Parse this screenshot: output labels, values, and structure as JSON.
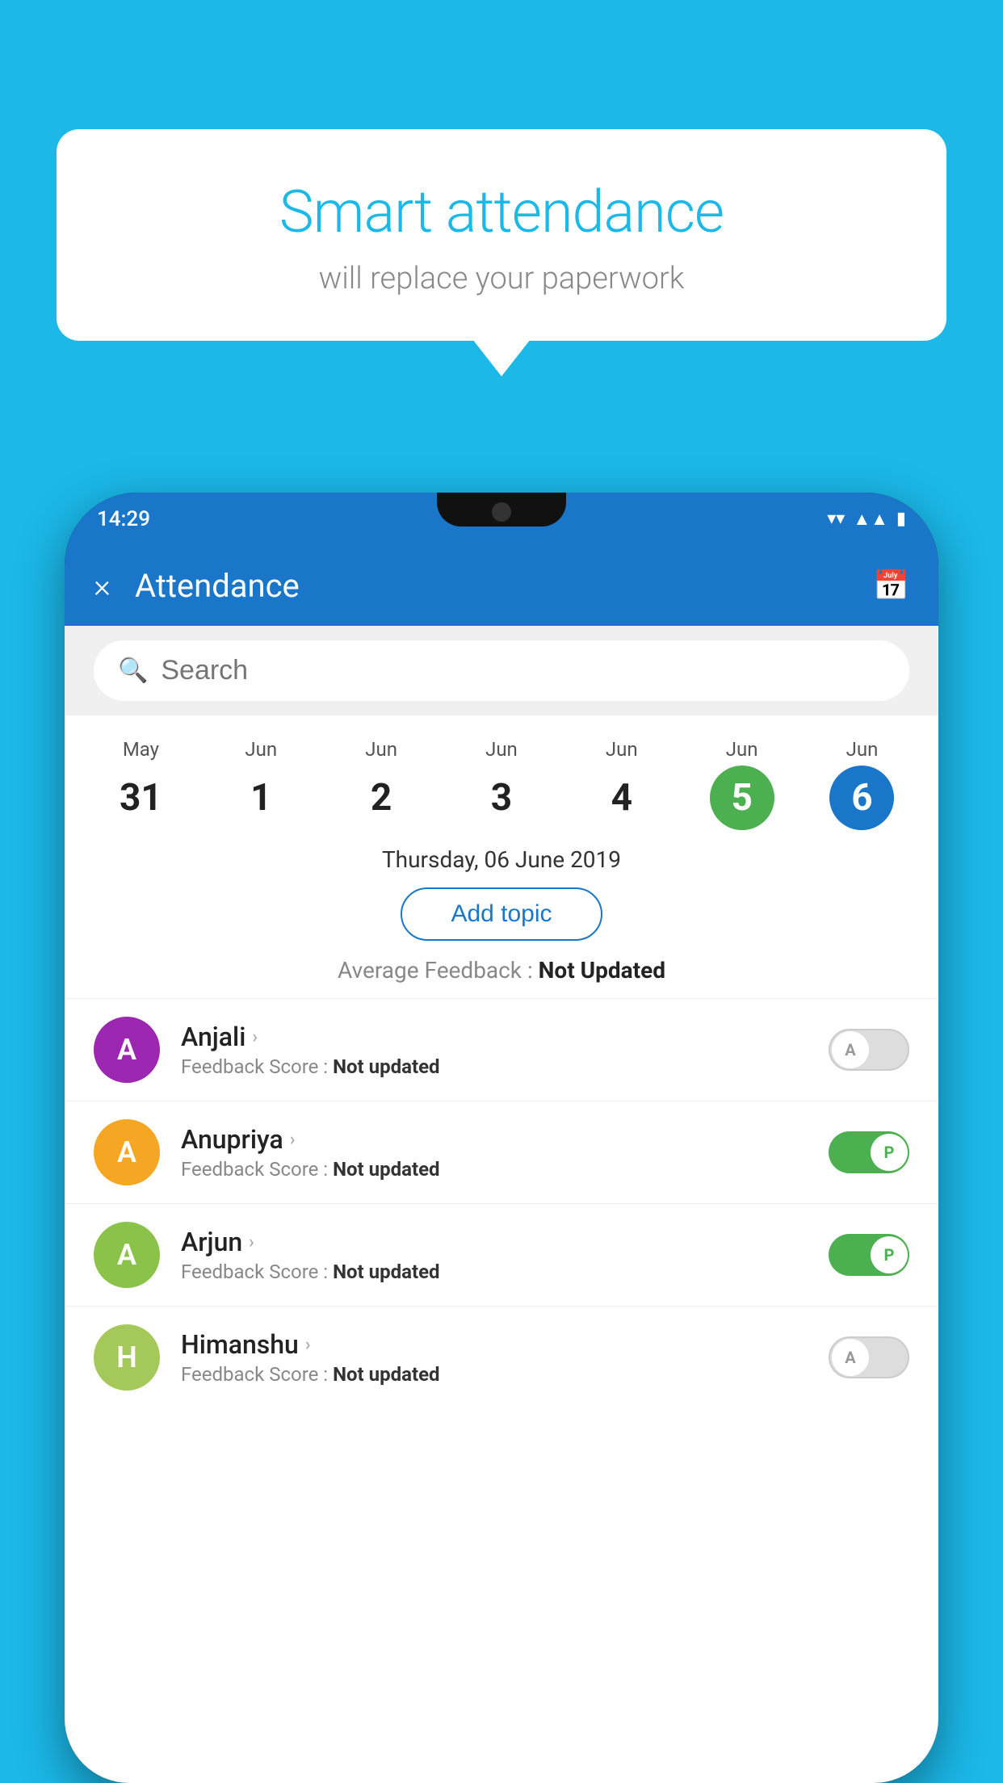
{
  "background_color": "#1bb8e8",
  "speech_bubble": {
    "title": "Smart attendance",
    "subtitle": "will replace your paperwork"
  },
  "status_bar": {
    "time": "14:29",
    "icons": [
      "wifi",
      "signal",
      "battery"
    ]
  },
  "app_bar": {
    "title": "Attendance",
    "close_label": "×",
    "calendar_icon": "📅"
  },
  "search": {
    "placeholder": "Search"
  },
  "calendar": {
    "dates": [
      {
        "month": "May",
        "day": "31",
        "state": "normal"
      },
      {
        "month": "Jun",
        "day": "1",
        "state": "normal"
      },
      {
        "month": "Jun",
        "day": "2",
        "state": "normal"
      },
      {
        "month": "Jun",
        "day": "3",
        "state": "normal"
      },
      {
        "month": "Jun",
        "day": "4",
        "state": "normal"
      },
      {
        "month": "Jun",
        "day": "5",
        "state": "today"
      },
      {
        "month": "Jun",
        "day": "6",
        "state": "selected"
      }
    ],
    "selected_date_label": "Thursday, 06 June 2019"
  },
  "add_topic_button": "Add topic",
  "avg_feedback": {
    "label": "Average Feedback : ",
    "value": "Not Updated"
  },
  "students": [
    {
      "name": "Anjali",
      "avatar_letter": "A",
      "avatar_color": "#9c27b0",
      "feedback_label": "Feedback Score : ",
      "feedback_value": "Not updated",
      "toggle_state": "off",
      "toggle_letter": "A"
    },
    {
      "name": "Anupriya",
      "avatar_letter": "A",
      "avatar_color": "#f5a623",
      "feedback_label": "Feedback Score : ",
      "feedback_value": "Not updated",
      "toggle_state": "on",
      "toggle_letter": "P"
    },
    {
      "name": "Arjun",
      "avatar_letter": "A",
      "avatar_color": "#8bc34a",
      "feedback_label": "Feedback Score : ",
      "feedback_value": "Not updated",
      "toggle_state": "on",
      "toggle_letter": "P"
    },
    {
      "name": "Himanshu",
      "avatar_letter": "H",
      "avatar_color": "#a5c85a",
      "feedback_label": "Feedback Score : ",
      "feedback_value": "Not updated",
      "toggle_state": "off",
      "toggle_letter": "A"
    }
  ]
}
